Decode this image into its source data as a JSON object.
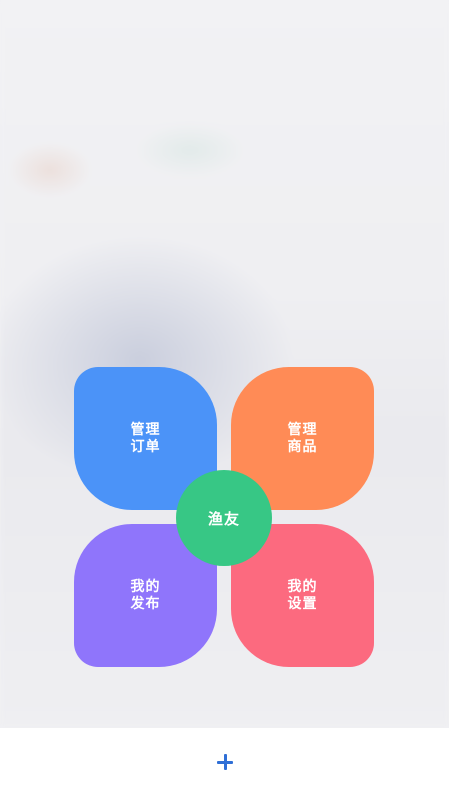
{
  "menu": {
    "center_label": "渔友",
    "items": [
      {
        "line1": "管理",
        "line2": "订单",
        "color": "#4b93f8"
      },
      {
        "line1": "管理",
        "line2": "商品",
        "color": "#ff8b56"
      },
      {
        "line1": "我的",
        "line2": "发布",
        "color": "#8f75fb"
      },
      {
        "line1": "我的",
        "line2": "设置",
        "color": "#fc6a7f"
      }
    ],
    "center_color": "#37c785"
  },
  "bottom_bar": {
    "button_icon": "plus-icon",
    "accent_color": "#2f6fd6"
  }
}
